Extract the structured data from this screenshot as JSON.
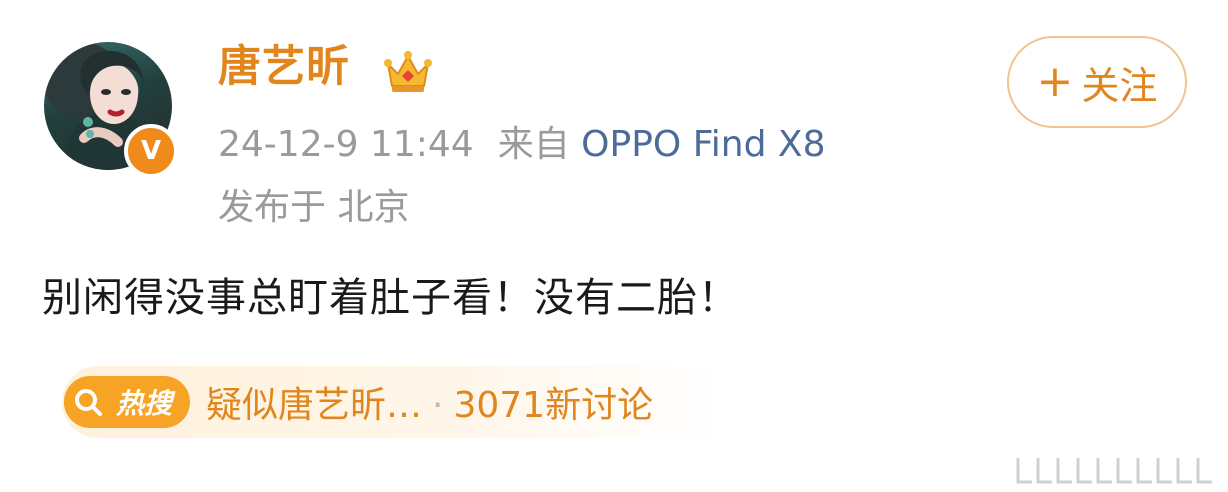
{
  "post": {
    "author_name": "唐艺昕",
    "timestamp": "24-12-9 11:44",
    "source_prefix": "来自",
    "device": "OPPO Find X8",
    "location": "发布于 北京",
    "content": "别闲得没事总盯着肚子看！没有二胎！"
  },
  "follow_button": {
    "plus": "+",
    "label": "关注"
  },
  "hot_search": {
    "badge_label": "热搜",
    "topic": "疑似唐艺昕…",
    "separator": "·",
    "discussion": "3071新讨论"
  },
  "icons": {
    "crown": "crown-icon",
    "verified": "verified-badge-icon",
    "search": "search-icon",
    "watermark": "watermark-bars-icon"
  },
  "colors": {
    "accent": "#e0861d",
    "device_link": "#4c6b9a",
    "meta_gray": "#9a9a9a",
    "hot_badge": "#f7a325"
  }
}
